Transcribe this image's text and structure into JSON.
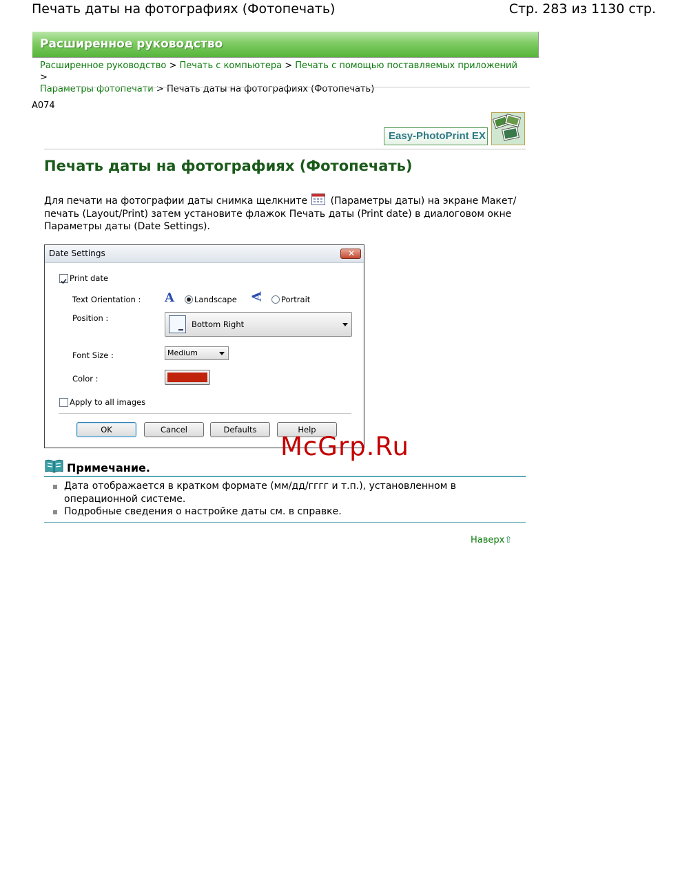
{
  "header": {
    "title": "Печать даты на фотографиях (Фотопечать)",
    "page_info": "Стр. 283 из 1130 стр."
  },
  "banner": {
    "label": "Расширенное руководство"
  },
  "breadcrumb": {
    "items": [
      "Расширенное руководство",
      "Печать с компьютера",
      "Печать с помощью поставляемых приложений",
      "Параметры фотопечати"
    ],
    "separator": ">",
    "current": "Печать даты на фотографиях (Фотопечать)"
  },
  "doc_id": "A074",
  "product_logo": {
    "label": "Easy-PhotoPrint EX",
    "icon": "photos-stack-icon"
  },
  "main": {
    "title": "Печать даты на фотографиях (Фотопечать)",
    "intro_part1": "Для печати на фотографии даты снимка щелкните",
    "intro_icon": "date-settings-icon",
    "intro_part2": "(Параметры даты) на экране Макет/печать (Layout/Print) затем установите флажок Печать даты (Print date) в диалоговом окне Параметры даты (Date Settings)."
  },
  "dialog": {
    "title": "Date Settings",
    "print_date_label": "Print date",
    "print_date_checked": true,
    "text_orientation_label": "Text Orientation :",
    "landscape_label": "Landscape",
    "landscape_selected": true,
    "portrait_label": "Portrait",
    "position_label": "Position :",
    "position_value": "Bottom Right",
    "font_size_label": "Font Size :",
    "font_size_value": "Medium",
    "color_label": "Color :",
    "color_value": "#c0240a",
    "apply_all_label": "Apply to all images",
    "apply_all_checked": false,
    "buttons": {
      "ok": "OK",
      "cancel": "Cancel",
      "defaults": "Defaults",
      "help": "Help"
    }
  },
  "watermark": "McGrp.Ru",
  "note": {
    "icon": "book-icon",
    "title": "Примечание.",
    "items": [
      "Дата отображается в кратком формате (мм/дд/гггг и т.п.), установленном в операционной системе.",
      "Подробные сведения о настройке даты см. в справке."
    ]
  },
  "top_link": {
    "label": "Наверх",
    "icon": "arrow-up-icon"
  },
  "colors": {
    "accent_green": "#0a7a0a",
    "banner_green": "#56b53a",
    "note_line": "#5aa8b4"
  }
}
